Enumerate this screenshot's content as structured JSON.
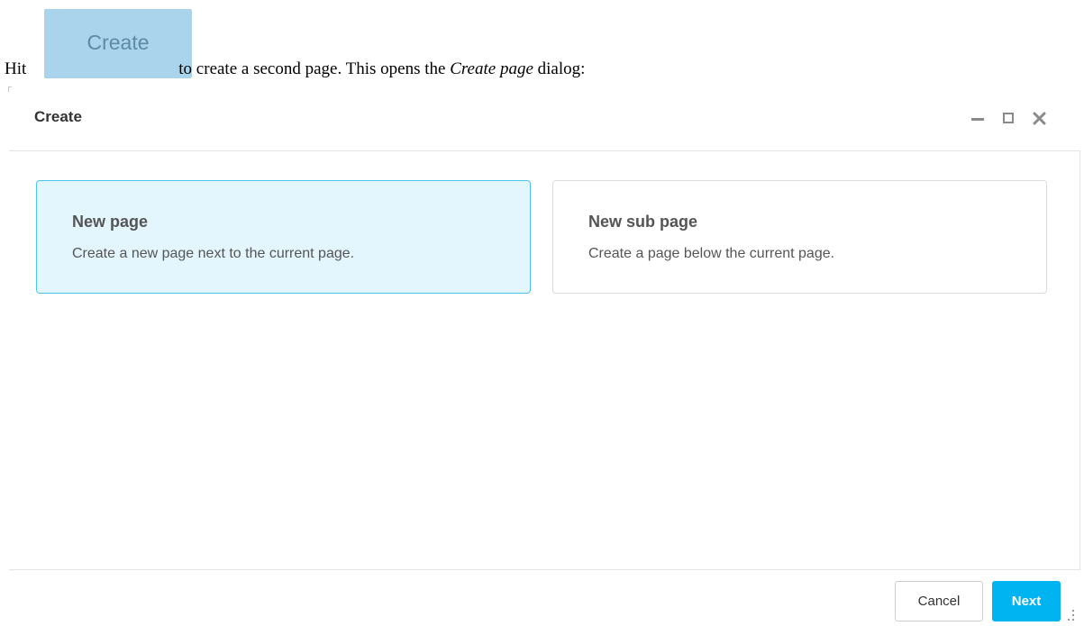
{
  "instruction": {
    "before": "Hit",
    "after": "to create a second page. This opens the",
    "dialog_name": "Create page",
    "end": "dialog:"
  },
  "inline_button": {
    "label": "Create"
  },
  "dialog": {
    "title": "Create",
    "window_controls": [
      "minimize-icon",
      "maximize-icon",
      "close-icon"
    ],
    "options": [
      {
        "title": "New page",
        "description": "Create a new page next to the current page.",
        "selected": true
      },
      {
        "title": "New sub page",
        "description": "Create a page below the current page.",
        "selected": false
      }
    ],
    "footer": {
      "cancel_label": "Cancel",
      "next_label": "Next"
    }
  },
  "colors": {
    "selected_card_bg": "#e3f6fe",
    "selected_card_border": "#4ec3f0",
    "primary_button": "#00b4f1",
    "inline_button_bg": "#a9d4ec"
  }
}
